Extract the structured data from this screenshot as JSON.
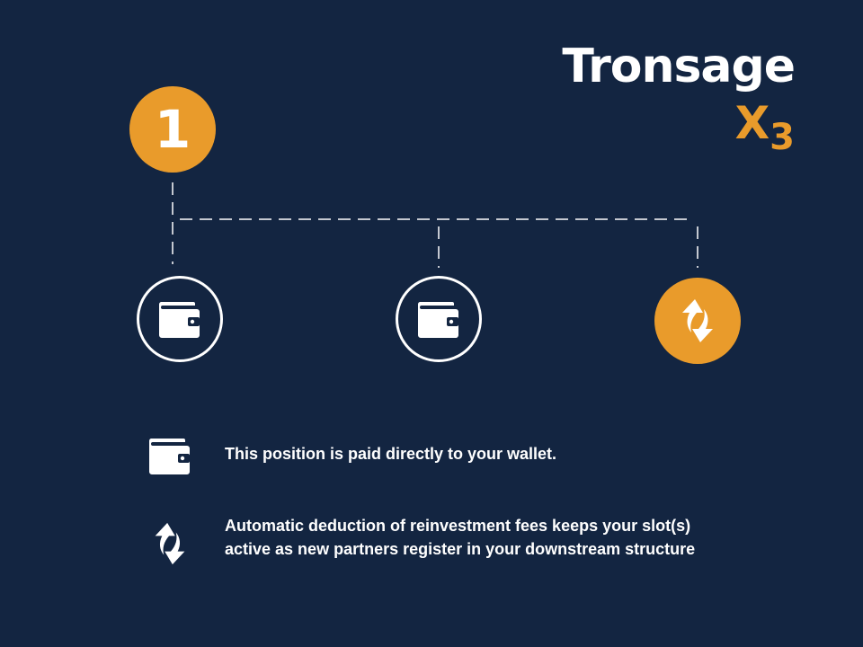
{
  "brand": {
    "name": "Tronsage",
    "sub_main": "X",
    "sub_index": "3"
  },
  "level": {
    "number": "1"
  },
  "slots": [
    {
      "icon": "wallet-icon",
      "style": "outline"
    },
    {
      "icon": "wallet-icon",
      "style": "outline"
    },
    {
      "icon": "reinvest-arrows-icon",
      "style": "filled"
    }
  ],
  "legend": {
    "wallet_text": "This position is paid directly to your  wallet.",
    "reinvest_line1": "Automatic deduction of reinvestment fees keeps your slot(s)",
    "reinvest_line2": "active as new partners register in your downstream structure"
  },
  "colors": {
    "background": "#132541",
    "accent": "#e99b2b",
    "foreground": "#ffffff"
  }
}
